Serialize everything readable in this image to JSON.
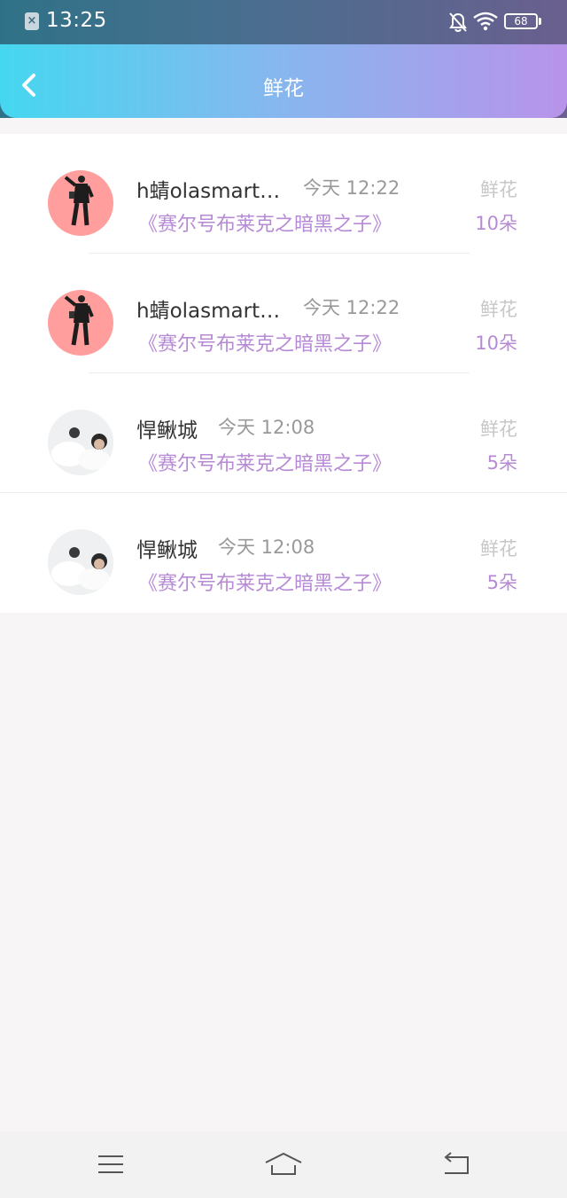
{
  "status_bar": {
    "time": "13:25",
    "battery": "68"
  },
  "header": {
    "title": "鲜花"
  },
  "items": [
    {
      "name": "h蜻olasmart…",
      "time": "今天 12:22",
      "book": "《赛尔号布莱克之暗黑之子》",
      "gift_label": "鲜花",
      "count": "10朵"
    },
    {
      "name": "h蜻olasmart…",
      "time": "今天 12:22",
      "book": "《赛尔号布莱克之暗黑之子》",
      "gift_label": "鲜花",
      "count": "10朵"
    },
    {
      "name": "悍鳅城",
      "time": "今天 12:08",
      "book": "《赛尔号布莱克之暗黑之子》",
      "gift_label": "鲜花",
      "count": "5朵"
    },
    {
      "name": "悍鳅城",
      "time": "今天 12:08",
      "book": "《赛尔号布莱克之暗黑之子》",
      "gift_label": "鲜花",
      "count": "5朵"
    }
  ],
  "colors": {
    "accent_purple": "#b78ad6",
    "header_start": "#45d7f0",
    "header_end": "#b893ea"
  }
}
